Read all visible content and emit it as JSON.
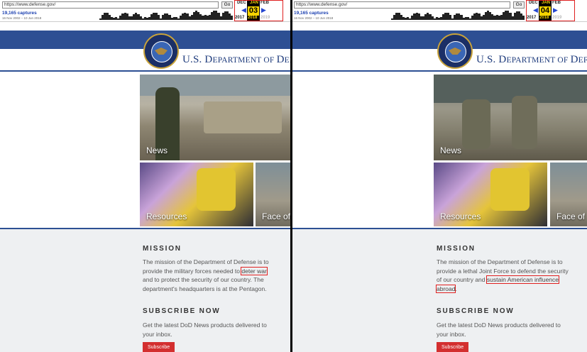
{
  "left": {
    "wayback": {
      "url": "https://www.defense.gov/",
      "go_label": "Go",
      "captures": "19,165 captures",
      "range": "16 Nov 2002 – 10 Jun 2018",
      "months": {
        "prev": "DEC",
        "cur": "JAN",
        "next": "FEB"
      },
      "day": "03",
      "years": {
        "prev": "2017",
        "cur": "2018",
        "next": "2019"
      }
    },
    "header": {
      "title_first": "U.S. D",
      "title_sc1": "EPARTMENT OF ",
      "title_d": "D",
      "title_sc2": "EFENSE"
    },
    "tiles": {
      "news": "News",
      "resources": "Resources",
      "face": "Face of"
    },
    "mission": {
      "heading": "MISSION",
      "text_before": "The mission of the Department of Defense is to provide the military forces needed to ",
      "highlight": "deter war",
      "text_after": " and to protect the security of our country. The department's headquarters is at the Pentagon."
    },
    "subscribe": {
      "heading": "SUBSCRIBE NOW",
      "text": "Get the latest DoD News products delivered to your inbox.",
      "button": "Subscribe"
    }
  },
  "right": {
    "wayback": {
      "url": "https://www.defense.gov/",
      "go_label": "Go",
      "captures": "19,165 captures",
      "range": "16 Nov 2002 – 10 Jun 2018",
      "months": {
        "prev": "DEC",
        "cur": "JAN",
        "next": "FEB"
      },
      "day": "04",
      "years": {
        "prev": "2017",
        "cur": "2018",
        "next": "2019"
      }
    },
    "header": {
      "title_first": "U.S. D",
      "title_sc1": "EPARTMENT OF ",
      "title_d": "D",
      "title_sc2": "EFENSE"
    },
    "tiles": {
      "news": "News",
      "resources": "Resources",
      "face": "Face of"
    },
    "mission": {
      "heading": "MISSION",
      "text_before": "The mission of the Department of Defense is to provide a lethal Joint Force to defend the security of our country and ",
      "highlight": "sustain American influence abroad",
      "text_after": "."
    },
    "subscribe": {
      "heading": "SUBSCRIBE NOW",
      "text": "Get the latest DoD News products delivered to your inbox.",
      "button": "Subscribe"
    }
  },
  "colors": {
    "dod_blue": "#2d4f93",
    "highlight_box": "#e02020",
    "subscribe_red": "#d32f2f",
    "wayback_day": "#f5d400"
  }
}
